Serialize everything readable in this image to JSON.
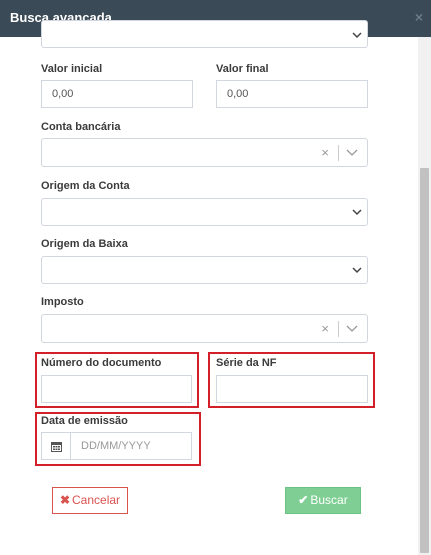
{
  "modal": {
    "title": "Busca avançada",
    "close_glyph": "×"
  },
  "fields": {
    "valor_inicial": {
      "label": "Valor inicial",
      "value": "0,00"
    },
    "valor_final": {
      "label": "Valor final",
      "value": "0,00"
    },
    "conta_bancaria": {
      "label": "Conta bancária",
      "value": "",
      "clear_glyph": "×"
    },
    "origem_conta": {
      "label": "Origem da Conta",
      "value": ""
    },
    "origem_baixa": {
      "label": "Origem da Baixa",
      "value": ""
    },
    "imposto": {
      "label": "Imposto",
      "value": "",
      "clear_glyph": "×"
    },
    "numero_documento": {
      "label": "Número do documento",
      "value": ""
    },
    "serie_nf": {
      "label": "Série da NF",
      "value": ""
    },
    "data_emissao": {
      "label": "Data de emissão",
      "placeholder": "DD/MM/YYYY",
      "icon": "calendar-icon"
    }
  },
  "buttons": {
    "cancel": {
      "label": "Cancelar",
      "icon_glyph": "✖",
      "color": "#d9534f"
    },
    "search": {
      "label": "Buscar",
      "icon_glyph": "✔",
      "color": "#7fcf95"
    }
  },
  "colors": {
    "header_bg": "#3a4a56",
    "highlight_border": "#d32028"
  }
}
